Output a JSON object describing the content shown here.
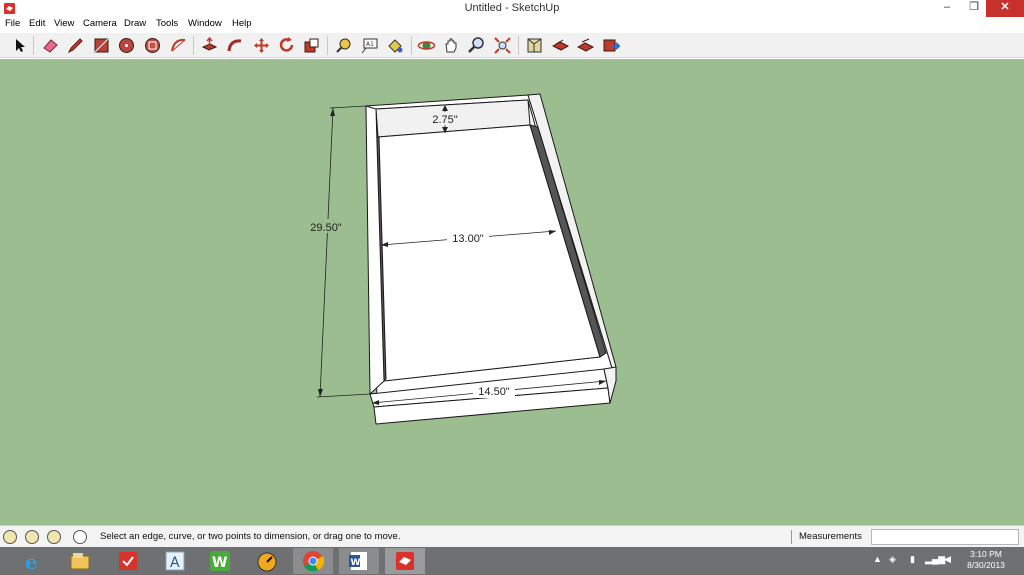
{
  "window": {
    "title": "Untitled - SketchUp",
    "controls": {
      "minimize": "–",
      "restore": "❐",
      "close": "✕"
    }
  },
  "menu": {
    "items": [
      "File",
      "Edit",
      "View",
      "Camera",
      "Draw",
      "Tools",
      "Window",
      "Help"
    ]
  },
  "toolbar": {
    "tools": [
      "select-tool",
      "eraser-tool",
      "pencil-tool",
      "rectangle-tool",
      "circle-tool",
      "polygon-tool",
      "arc-tool",
      "push-pull-tool",
      "follow-me-tool",
      "move-tool",
      "rotate-tool",
      "scale-tool",
      "tape-measure-tool",
      "text-tool",
      "paint-bucket-tool",
      "orbit-tool",
      "pan-tool",
      "zoom-tool",
      "zoom-extents-tool",
      "components-tool",
      "get-models-tool",
      "share-model-tool",
      "send-to-layout-tool"
    ]
  },
  "model": {
    "dimensions": {
      "height": "29.50\"",
      "thickness": "2.75\"",
      "inner_width": "13.00\"",
      "outer_width": "14.50\""
    },
    "colors": {
      "background": "#9bbd90",
      "face": "#ffffff",
      "edge": "#1a1a1a",
      "shade": "#555555"
    }
  },
  "status": {
    "hint": "Select an edge, curve, or two points to dimension, or drag one to move.",
    "measurements_label": "Measurements",
    "measurements_value": ""
  },
  "taskbar": {
    "apps": [
      "internet-explorer",
      "file-explorer",
      "todoist",
      "autodesk",
      "wunderlist",
      "speed-dial",
      "chrome",
      "word",
      "sketchup"
    ],
    "time": "3:10 PM",
    "date": "8/30/2013"
  }
}
